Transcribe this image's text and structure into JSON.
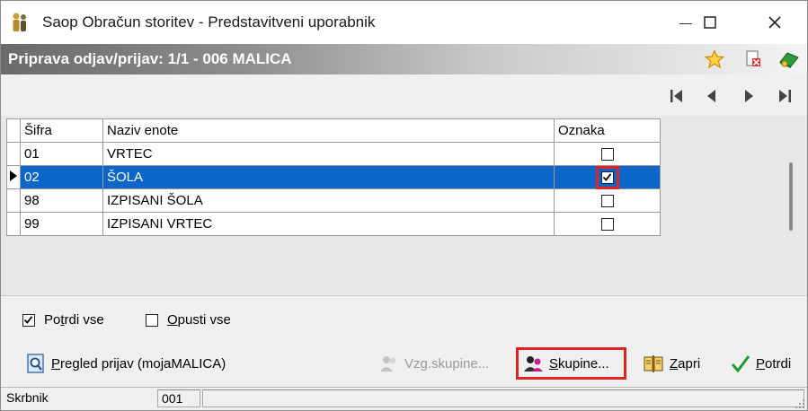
{
  "window": {
    "title": "Saop Obračun storitev - Predstavitveni uporabnik",
    "controls": {
      "minimize": "—",
      "maximize": "☐",
      "close": "✕"
    }
  },
  "caption": {
    "text": "Priprava odjav/prijav: 1/1 - 006 MALICA"
  },
  "nav": {
    "first": "first-record",
    "prev": "previous-record",
    "next": "next-record",
    "last": "last-record"
  },
  "grid": {
    "columns": {
      "code": "Šifra",
      "name": "Naziv enote",
      "mark": "Oznaka"
    },
    "rows": [
      {
        "code": "01",
        "name": "VRTEC",
        "checked": false,
        "selected": false
      },
      {
        "code": "02",
        "name": "ŠOLA",
        "checked": true,
        "selected": true
      },
      {
        "code": "98",
        "name": "IZPISANI ŠOLA",
        "checked": false,
        "selected": false
      },
      {
        "code": "99",
        "name": "IZPISANI VRTEC",
        "checked": false,
        "selected": false
      }
    ]
  },
  "options": {
    "confirm_all": {
      "label_pre": "Po",
      "label_acc": "t",
      "label_post": "rdi vse",
      "checked": true
    },
    "skip_all": {
      "label_pre": "",
      "label_acc": "O",
      "label_post": "pusti vse",
      "checked": false
    }
  },
  "buttons": {
    "review": {
      "label_pre": "",
      "label_acc": "P",
      "label_post": "regled prijav (mojaMALICA)"
    },
    "vzg_groups": {
      "label": "Vzg.skupine..."
    },
    "groups": {
      "label_pre": "",
      "label_acc": "S",
      "label_post": "kupine..."
    },
    "close": {
      "label_pre": "",
      "label_acc": "Z",
      "label_post": "apri"
    },
    "confirm": {
      "label_pre": "",
      "label_acc": "P",
      "label_post": "otrdi"
    }
  },
  "status": {
    "field1": "Skrbnik",
    "field2": "001",
    "field3": ""
  },
  "colors": {
    "selection": "#0a66c8",
    "highlight": "#e02424",
    "caption_dark": "#6a6a6a"
  }
}
